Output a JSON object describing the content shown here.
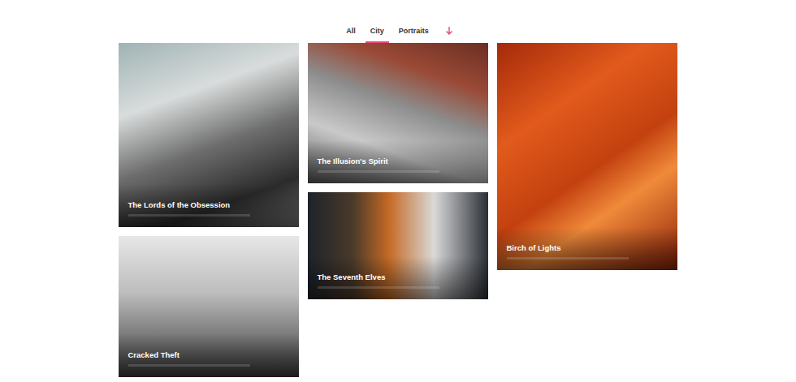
{
  "tabs": [
    {
      "label": "All",
      "selected": false
    },
    {
      "label": "City",
      "selected": true
    },
    {
      "label": "Portraits",
      "selected": false
    }
  ],
  "items": [
    {
      "title": "The Lords of the Obsession"
    },
    {
      "title": "The Illusion's Spirit"
    },
    {
      "title": "Birch of Lights"
    },
    {
      "title": "Cracked Theft"
    },
    {
      "title": "The Seventh Elves"
    }
  ]
}
